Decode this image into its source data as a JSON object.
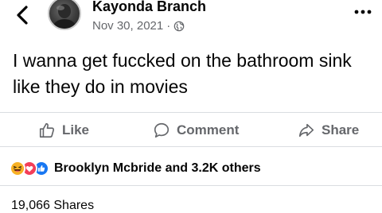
{
  "post": {
    "author": "Kayonda Branch",
    "date": "Nov 30, 2021",
    "date_separator": "·",
    "privacy_icon": "globe-icon",
    "text": "I wanna get fuccked on the bathroom sink like they do in movies"
  },
  "header": {
    "back_icon": "chevron-left-icon",
    "more_icon": "more-dots-icon"
  },
  "actions": {
    "like_label": "Like",
    "comment_label": "Comment",
    "share_label": "Share"
  },
  "reactions": {
    "types": [
      "haha",
      "love",
      "like"
    ],
    "summary": "Brooklyn Mcbride and 3.2K others"
  },
  "stats": {
    "shares": "19,066 Shares"
  },
  "colors": {
    "text": "#050505",
    "secondary": "#65676b",
    "like_blue": "#1877f2",
    "love_red": "#f33e58",
    "haha_yellow": "#f7b125"
  }
}
